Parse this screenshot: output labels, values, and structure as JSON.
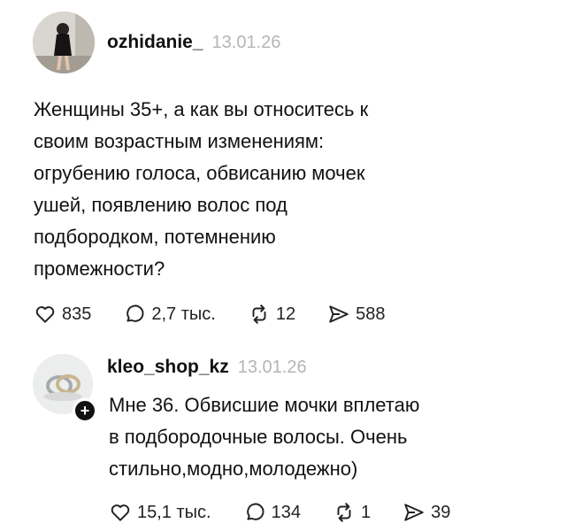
{
  "post": {
    "username": "ozhidanie_",
    "date": "13.01.26",
    "text": "Женщины 35+, а как вы относитесь к\nсвоим возрастным изменениям:\nогрубению голоса,  обвисанию мочек\nушей, появлению волос под\nподбородком, потемнению\nпромежности?",
    "likes": "835",
    "replies": "2,7 тыс.",
    "reposts": "12",
    "shares": "588"
  },
  "reply": {
    "username": "kleo_shop_kz",
    "date": "13.01.26",
    "text": "Мне 36. Обвисшие мочки вплетаю\nв подбородочные волосы.  Очень\nстильно,модно,молодежно)",
    "likes": "15,1 тыс.",
    "replies": "134",
    "reposts": "1",
    "shares": "39"
  },
  "icons": {
    "like": "heart-icon",
    "reply": "comment-bubble-icon",
    "repost": "repost-icon",
    "share": "send-icon",
    "follow": "plus-icon"
  }
}
